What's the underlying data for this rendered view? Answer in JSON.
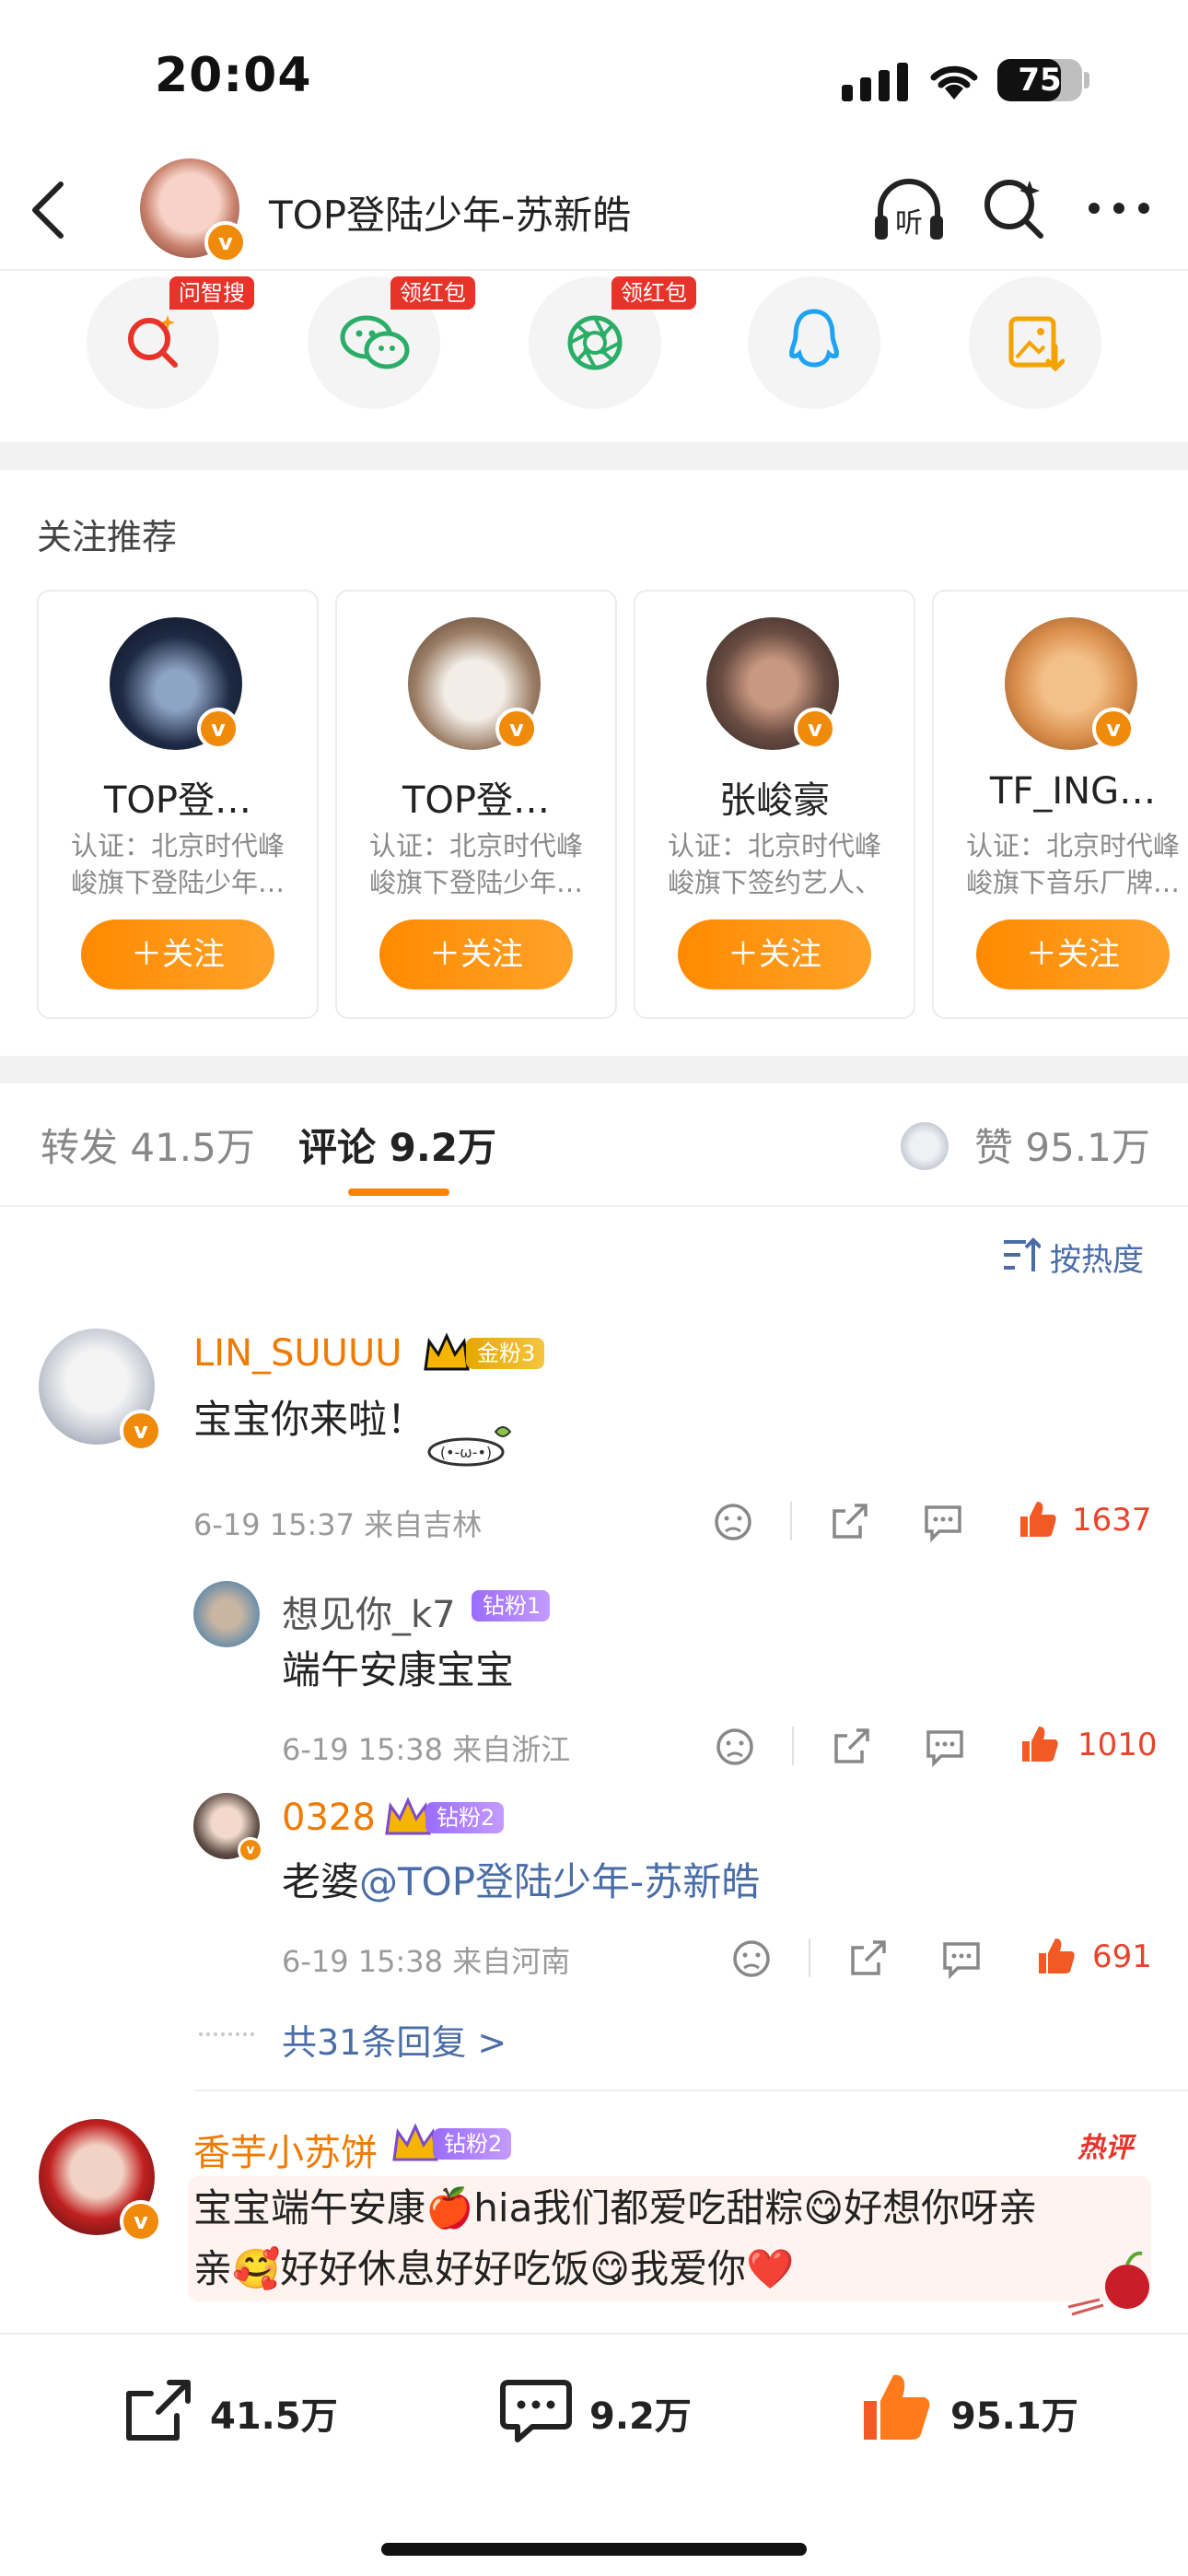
{
  "status_bar": {
    "time": "20:04",
    "battery": "75",
    "battery_level": 0.75
  },
  "header": {
    "title": "TOP登陆少年-苏新皓"
  },
  "share": {
    "badges": [
      "问智搜",
      "领红包",
      "领红包"
    ]
  },
  "recommend": {
    "title": "关注推荐",
    "follow_label": "＋关注",
    "cards": [
      {
        "name": "TOP登…",
        "desc": "认证：北京时代峰峻旗下登陆少年…"
      },
      {
        "name": "TOP登…",
        "desc": "认证：北京时代峰峻旗下登陆少年…"
      },
      {
        "name": "张峻豪",
        "desc": "认证：北京时代峰峻旗下签约艺人、"
      },
      {
        "name": "TF_ING…",
        "desc": "认证：北京时代峰峻旗下音乐厂牌…"
      }
    ]
  },
  "tabs": {
    "repost": "转发 41.5万",
    "comment": "评论 9.2万",
    "like": "赞 95.1万"
  },
  "sort_label": "按热度",
  "comments": [
    {
      "name": "LIN_SUUUU",
      "badge": "金粉3",
      "text": "宝宝你来啦！",
      "meta": "6-19 15:37  来自吉林",
      "likes": "1637",
      "replies": [
        {
          "name": "想见你_k7",
          "badge": "钻粉1",
          "text": "端午安康宝宝",
          "meta": "6-19 15:38  来自浙江",
          "likes": "1010"
        },
        {
          "name": "0328",
          "badge": "钻粉2",
          "text_prefix": "老婆",
          "mention": "@TOP登陆少年-苏新皓",
          "meta": "6-19 15:38  来自河南",
          "likes": "691"
        }
      ],
      "more_replies": "共31条回复 >"
    },
    {
      "name": "香芋小苏饼",
      "badge": "钻粉2",
      "hot_label": "热评",
      "line1": "宝宝端午安康🍎hia我们都爱吃甜粽😋好想你呀亲",
      "line2": "亲🥰好好休息好好吃饭😋我爱你❤️"
    }
  ],
  "bottom_bar": {
    "repost": "41.5万",
    "comment": "9.2万",
    "like": "95.1万"
  },
  "colors": {
    "accent": "#ff8200",
    "link": "#4a6da7",
    "like_red": "#e8432b"
  }
}
